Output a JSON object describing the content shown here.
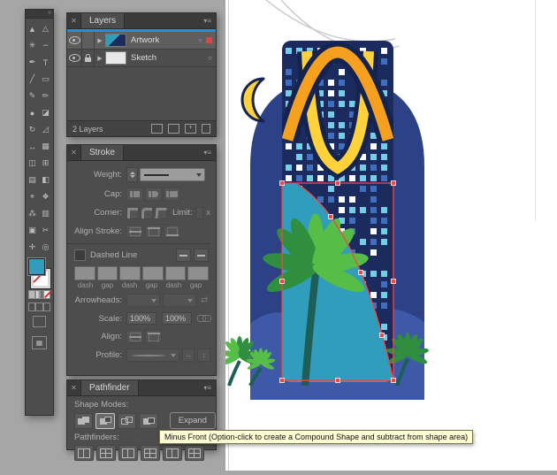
{
  "app": {
    "desktop_color": "#a6a6a6"
  },
  "toolbar": {
    "collapse": "»",
    "fill_color": "#2f9dbb",
    "tools": [
      {
        "name": "selection",
        "glyph": "▲"
      },
      {
        "name": "direct-selection",
        "glyph": "△"
      },
      {
        "name": "magic-wand",
        "glyph": "✳"
      },
      {
        "name": "lasso",
        "glyph": "∽"
      },
      {
        "name": "pen",
        "glyph": "✒"
      },
      {
        "name": "type",
        "glyph": "T"
      },
      {
        "name": "line-segment",
        "glyph": "╱"
      },
      {
        "name": "rectangle",
        "glyph": "▭"
      },
      {
        "name": "paintbrush",
        "glyph": "✎"
      },
      {
        "name": "pencil",
        "glyph": "✏"
      },
      {
        "name": "blob-brush",
        "glyph": "●"
      },
      {
        "name": "eraser",
        "glyph": "◪"
      },
      {
        "name": "rotate",
        "glyph": "↻"
      },
      {
        "name": "scale",
        "glyph": "◿"
      },
      {
        "name": "width",
        "glyph": "↔"
      },
      {
        "name": "free-transform",
        "glyph": "▦"
      },
      {
        "name": "shape-builder",
        "glyph": "◫"
      },
      {
        "name": "perspective-grid",
        "glyph": "⊞"
      },
      {
        "name": "mesh",
        "glyph": "▤"
      },
      {
        "name": "gradient",
        "glyph": "◧"
      },
      {
        "name": "eyedropper",
        "glyph": "⌖"
      },
      {
        "name": "blend",
        "glyph": "❖"
      },
      {
        "name": "symbol-sprayer",
        "glyph": "⁂"
      },
      {
        "name": "column-graph",
        "glyph": "▥"
      },
      {
        "name": "artboard",
        "glyph": "▣"
      },
      {
        "name": "slice",
        "glyph": "✂"
      },
      {
        "name": "hand",
        "glyph": "✛"
      },
      {
        "name": "zoom",
        "glyph": "◎"
      }
    ]
  },
  "layers_panel": {
    "close": "✕",
    "tab": "Layers",
    "menu": "▾≡",
    "rows": [
      {
        "name": "Artwork"
      },
      {
        "name": "Sketch"
      }
    ],
    "footer": "2 Layers"
  },
  "stroke_panel": {
    "close": "✕",
    "tab": "Stroke",
    "menu": "▾≡",
    "weight_label": "Weight:",
    "cap_label": "Cap:",
    "corner_label": "Corner:",
    "limit_label": "Limit:",
    "limit_suffix": "x",
    "align_stroke_label": "Align Stroke:",
    "dashed_label": "Dashed Line",
    "dash_labels": [
      "dash",
      "gap",
      "dash",
      "gap",
      "dash",
      "gap"
    ],
    "arrowheads_label": "Arrowheads:",
    "scale_label": "Scale:",
    "scale_values": [
      "100%",
      "100%"
    ],
    "align_label": "Align:",
    "profile_label": "Profile:"
  },
  "pathfinder_panel": {
    "close": "✕",
    "tab": "Pathfinder",
    "menu": "▾≡",
    "shape_modes_label": "Shape Modes:",
    "shape_modes": [
      "Unite",
      "Minus Front",
      "Intersect",
      "Exclude"
    ],
    "expand_label": "Expand",
    "pathfinders_label": "Pathfinders:",
    "pathfinders": [
      "Divide",
      "Trim",
      "Merge",
      "Crop",
      "Outline",
      "Minus Back"
    ]
  },
  "tooltip": {
    "text": "Minus Front (Option-click to create a Compound Shape and subtract from shape area)"
  },
  "artwork": {
    "colors": {
      "arch": "#2c4186",
      "skyline": "#3d59a8",
      "building": "#1b2b5e",
      "navy": "#14234f",
      "orange": "#f5a01e",
      "yellow": "#ffd23c",
      "teal": "#2f9dbb",
      "window_cyan": "#6fd0e8",
      "window_white": "#ffffff",
      "window_blue": "#3f6fc0",
      "palm_green": "#56bd47",
      "palm_dark": "#2f8f3f",
      "trunk": "#1d5e57",
      "selection_red": "#ff4141",
      "sketch_line": "#c9c9c9",
      "artboard_line": "#d2d2d2"
    }
  }
}
